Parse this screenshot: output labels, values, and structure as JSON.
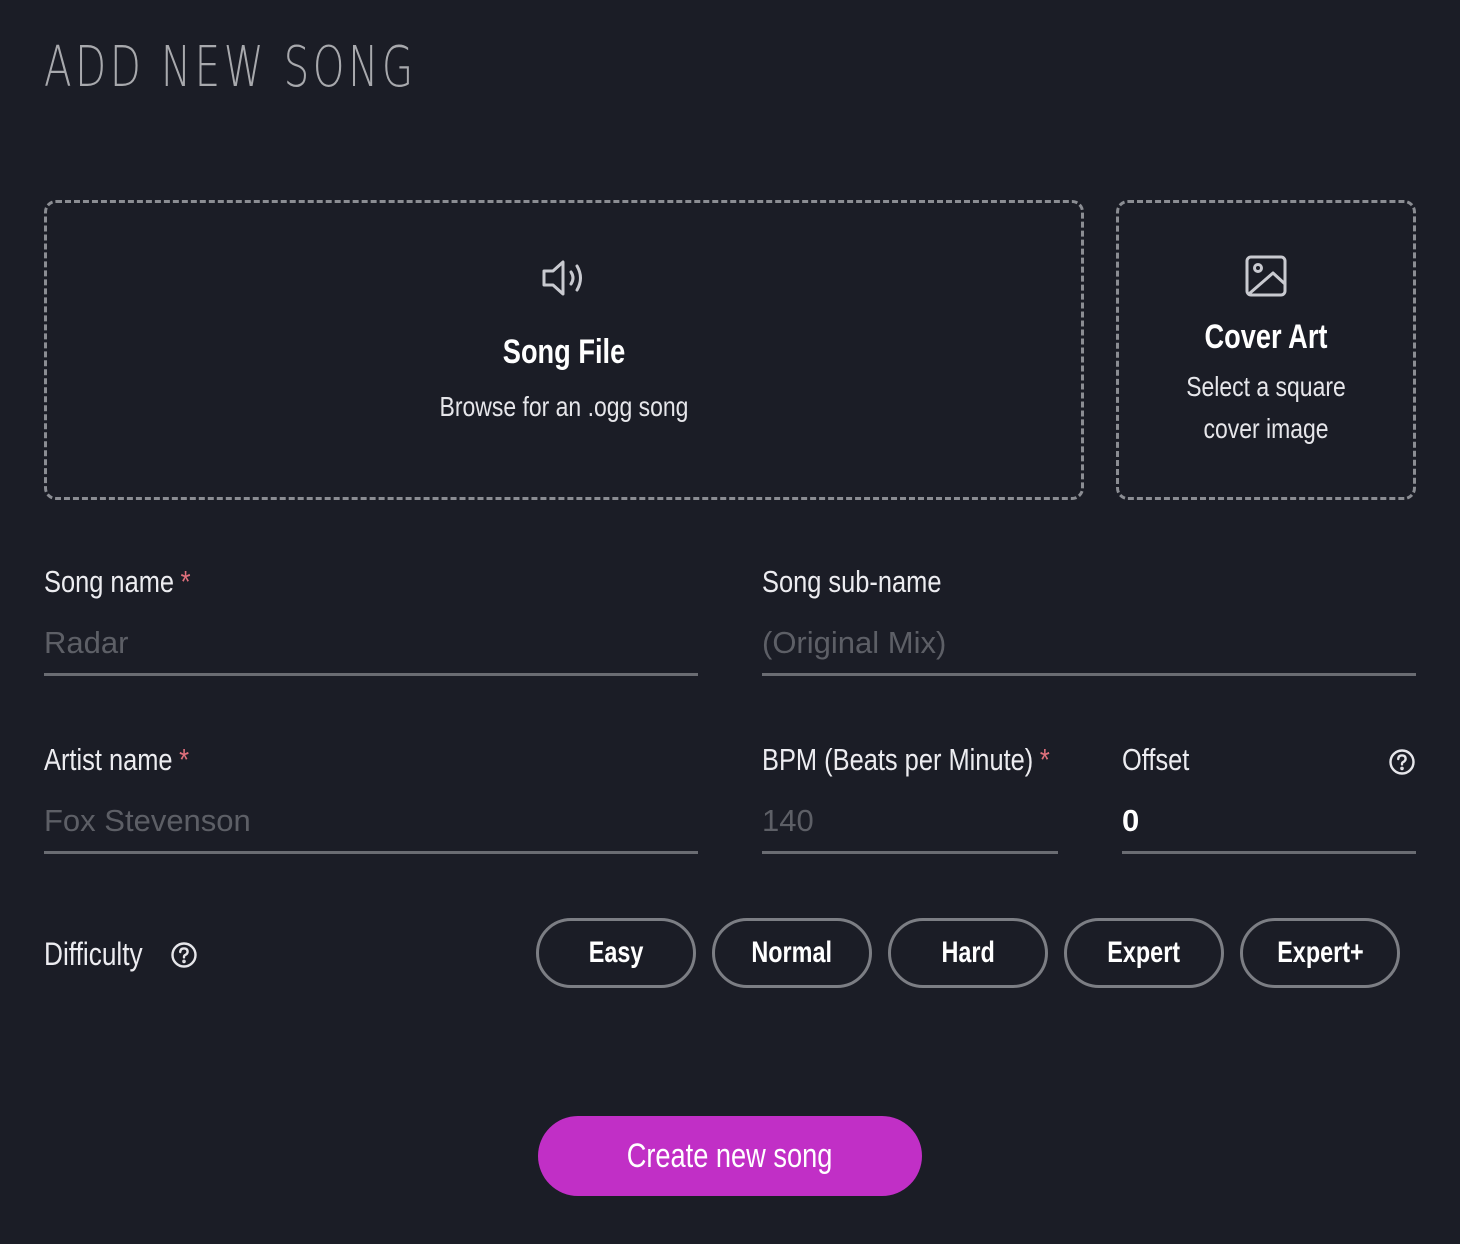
{
  "page": {
    "title": "ADD NEW SONG"
  },
  "song_file": {
    "icon": "speaker-icon",
    "title": "Song File",
    "subtitle": "Browse for an .ogg song"
  },
  "cover_art": {
    "icon": "image-icon",
    "title": "Cover Art",
    "subtitle": "Select a square cover image"
  },
  "form": {
    "song_name": {
      "label": "Song name",
      "required_mark": "*",
      "value": "",
      "placeholder": "Radar"
    },
    "song_sub_name": {
      "label": "Song sub-name",
      "value": "",
      "placeholder": "(Original Mix)"
    },
    "artist_name": {
      "label": "Artist name",
      "required_mark": "*",
      "value": "",
      "placeholder": "Fox Stevenson"
    },
    "bpm": {
      "label": "BPM (Beats per Minute)",
      "required_mark": "*",
      "value": "",
      "placeholder": "140"
    },
    "offset": {
      "label": "Offset",
      "value": "0",
      "help_icon": "help-circle-icon"
    }
  },
  "difficulty": {
    "label": "Difficulty",
    "help_icon": "help-circle-icon",
    "options": [
      "Easy",
      "Normal",
      "Hard",
      "Expert",
      "Expert+"
    ]
  },
  "actions": {
    "create_label": "Create new song"
  },
  "colors": {
    "background": "#1b1d26",
    "accent": "#c12fc6",
    "required": "#e0707c",
    "border": "#8b8d93"
  }
}
